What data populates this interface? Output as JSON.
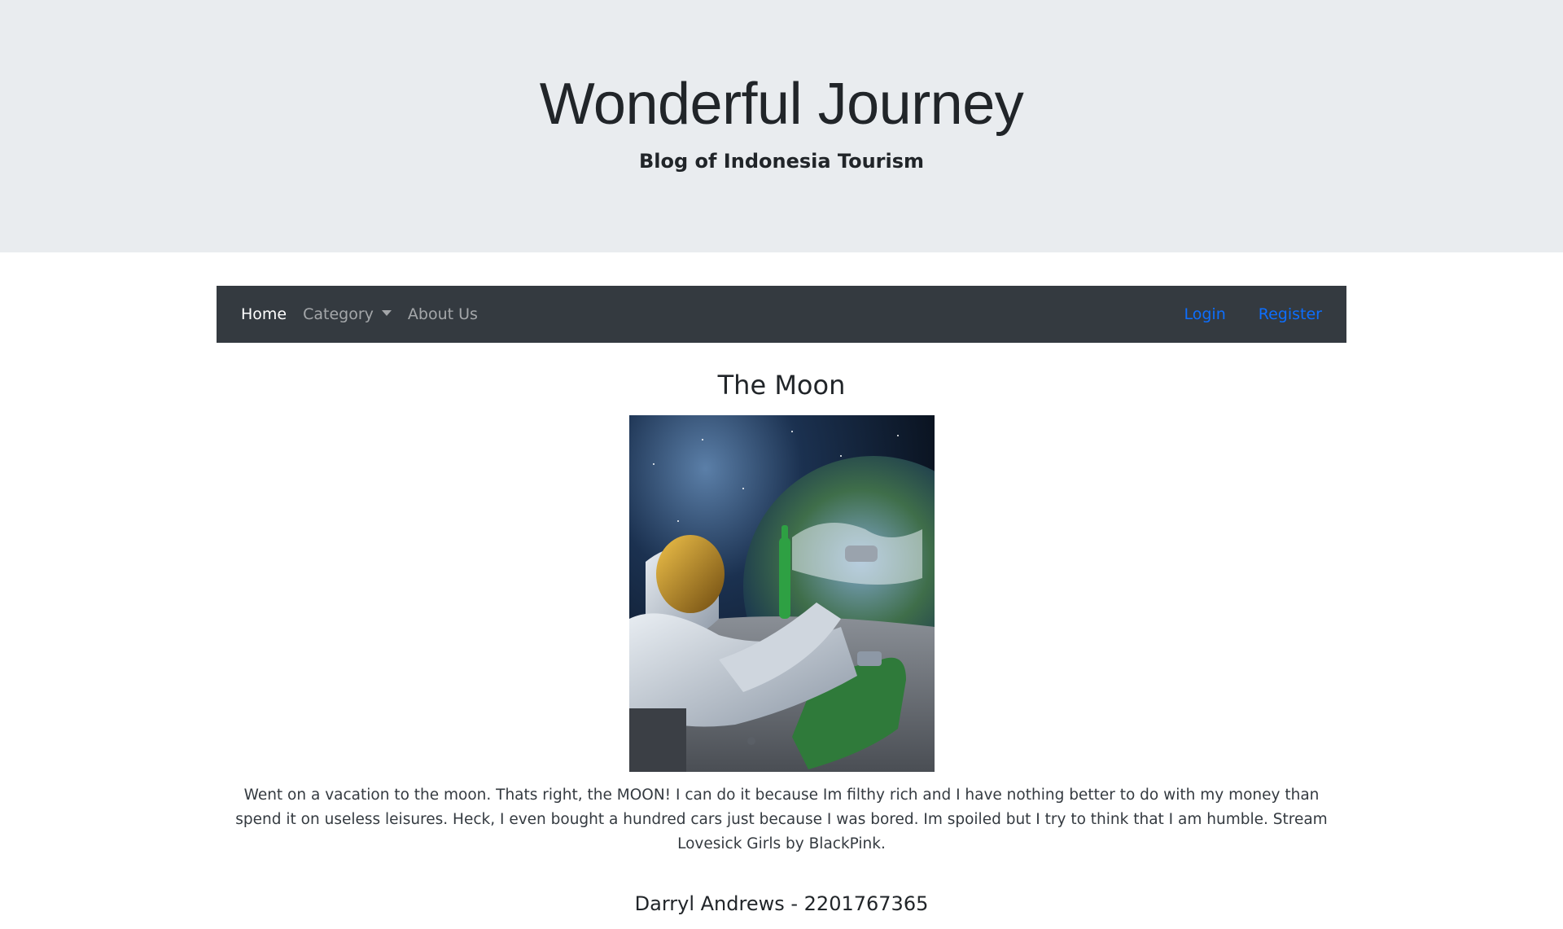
{
  "header": {
    "title": "Wonderful Journey",
    "subtitle": "Blog of Indonesia Tourism"
  },
  "nav": {
    "home": "Home",
    "category": "Category",
    "about": "About Us",
    "login": "Login",
    "register": "Register"
  },
  "post": {
    "title": "The Moon",
    "image_alt": "astronaut-on-moon-image",
    "body": "Went on a vacation to the moon. Thats right, the MOON! I can do it because Im filthy rich and I have nothing better to do with my money than spend it on useless leisures. Heck, I even bought a hundred cars just because I was bored. Im spoiled but I try to think that I am humble. Stream Lovesick Girls by BlackPink.",
    "author": "Darryl Andrews - 2201767365"
  },
  "colors": {
    "jumbotron_bg": "#e9ecef",
    "navbar_bg": "#343a40",
    "link_blue": "#0d6efd"
  }
}
